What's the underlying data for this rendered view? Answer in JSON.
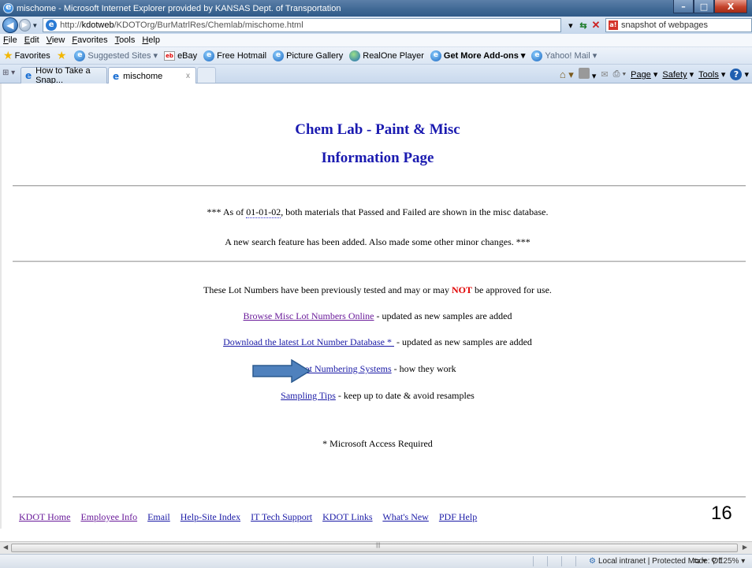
{
  "window": {
    "title": "mischome - Microsoft Internet Explorer provided by KANSAS Dept. of Transportation",
    "minimize": "–",
    "maximize": "□",
    "close": "X"
  },
  "address": {
    "url_prefix": "http://",
    "url_host": "kdotweb",
    "url_path": "/KDOTOrg/BurMatrlRes/Chemlab/mischome.html",
    "search_value": "snapshot of webpages"
  },
  "menu": [
    "File",
    "Edit",
    "View",
    "Favorites",
    "Tools",
    "Help"
  ],
  "favorites": {
    "label": "Favorites",
    "items": [
      {
        "label": "Suggested Sites ▾"
      },
      {
        "label": "eBay"
      },
      {
        "label": "Free Hotmail"
      },
      {
        "label": "Picture Gallery"
      },
      {
        "label": "RealOne Player"
      },
      {
        "label": "Get More Add-ons ▾"
      },
      {
        "label": "Yahoo! Mail ▾"
      }
    ]
  },
  "tabs": {
    "items": [
      {
        "label": "How to Take a Snap..."
      },
      {
        "label": "mischome"
      }
    ],
    "close_glyph": "x"
  },
  "commandbar": {
    "page": "Page",
    "safety": "Safety",
    "tools": "Tools"
  },
  "page": {
    "heading1": "Chem Lab - Paint & Misc",
    "heading2": "Information Page",
    "notice_prefix": "*** As of ",
    "notice_date": "01-01-02",
    "notice_suffix": ", both materials that Passed and Failed are shown in the misc database.",
    "notice_line2": "A new search feature has been added. Also made some other minor changes. ***",
    "lot_prefix": "These Lot Numbers have been previously tested and may or may ",
    "lot_not": "NOT",
    "lot_suffix": " be approved for use.",
    "links": [
      {
        "text": "Browse Misc Lot Numbers Online",
        "desc": " - updated as new samples are added"
      },
      {
        "text": "Download the latest Lot Number Database * ",
        "desc": " - updated as new samples are added"
      },
      {
        "text": "Lot Numbering Systems",
        "desc": " - how they work"
      },
      {
        "text": "Sampling Tips",
        "desc": " - keep up to date & avoid resamples"
      }
    ],
    "access_note": "* Microsoft Access Required",
    "arrow_color": "#4f81bd"
  },
  "footer": [
    "KDOT Home",
    "Employee Info",
    "Email",
    "Help-Site Index",
    "IT Tech Support",
    "KDOT Links",
    "What's New",
    "PDF Help"
  ],
  "slide_number": "16",
  "status": {
    "zone": "Local intranet | Protected Mode: Off",
    "zoom": "125%"
  }
}
